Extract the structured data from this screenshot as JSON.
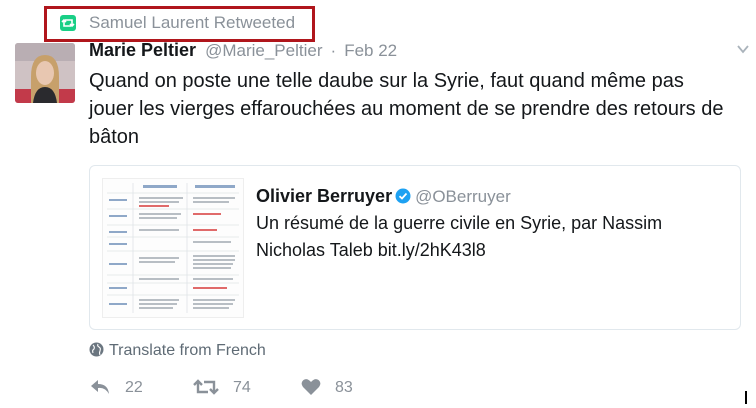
{
  "retweet": {
    "label": "Samuel Laurent Retweeted",
    "icon": "retweet-icon",
    "highlight_color": "#b0161c"
  },
  "tweet": {
    "author_name": "Marie Peltier",
    "author_handle": "@Marie_Peltier",
    "separator": "·",
    "date": "Feb 22",
    "text": "Quand on poste une telle daube sur la Syrie, faut quand même pas jouer les vierges effarouchées au moment de se prendre des retours de bâton",
    "menu_icon": "chevron-down-icon"
  },
  "quote": {
    "author_name": "Olivier Berruyer",
    "verified": true,
    "author_handle": "@OBerruyer",
    "text": "Un résumé de la guerre civile en Syrie, par Nassim Nicholas Taleb bit.ly/2hK43l8"
  },
  "translate": {
    "label": "Translate from French",
    "icon": "globe-icon"
  },
  "actions": {
    "reply_count": "22",
    "retweet_count": "74",
    "like_count": "83"
  },
  "colors": {
    "text": "#14171a",
    "muted": "#8a9199",
    "retweet_green": "#19cf86",
    "verified_blue": "#1da1f2"
  }
}
